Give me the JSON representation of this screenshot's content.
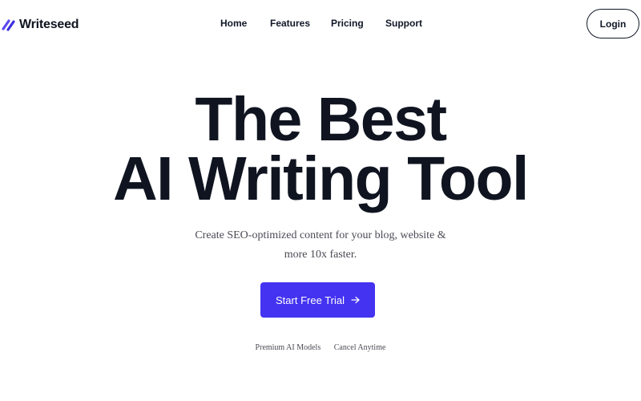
{
  "header": {
    "logo_text": "Writeseed",
    "logo_icon": "slash-mark-icon",
    "brand_color": "#4433f0",
    "nav": [
      {
        "label": "Home"
      },
      {
        "label": "Features"
      },
      {
        "label": "Pricing"
      },
      {
        "label": "Support"
      }
    ],
    "login_label": "Login"
  },
  "hero": {
    "title_line1": "The Best",
    "title_line2": "AI Writing Tool",
    "subtitle": "Create SEO-optimized content for your blog, website & more 10x faster.",
    "cta_label": "Start Free Trial",
    "cta_icon": "arrow-right-icon",
    "cta_color": "#4433f0",
    "features": [
      "Premium AI Models",
      "Cancel Anytime"
    ]
  }
}
